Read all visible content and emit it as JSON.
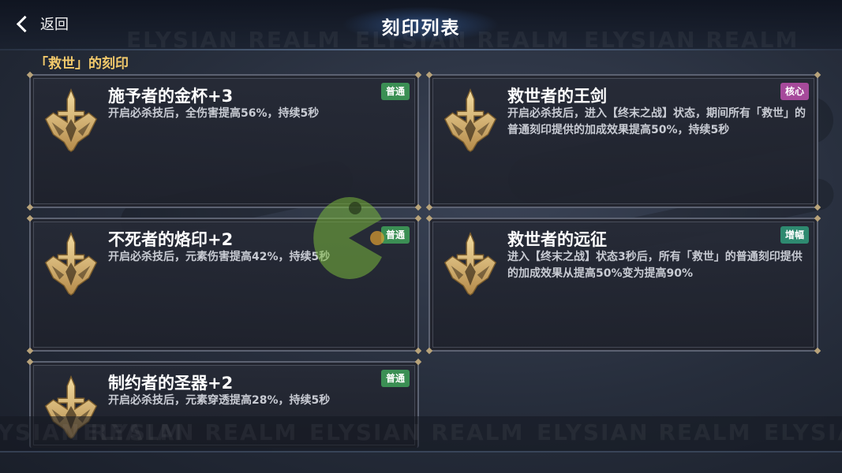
{
  "header": {
    "back_label": "返回",
    "title": "刻印列表"
  },
  "watermark_text": "ELYSIAN REALM",
  "section": {
    "heading": "「救世」的刻印"
  },
  "cards": [
    {
      "title": "施予者的金杯+3",
      "desc": "开启必杀技后，全伤害提高56%，持续5秒",
      "badge": "普通",
      "badge_color": "#3b8f54"
    },
    {
      "title": "救世者的王剑",
      "desc": "开启必杀技后，进入【终末之战】状态，期间所有「救世」的普通刻印提供的加成效果提高50%，持续5秒",
      "badge": "核心",
      "badge_color": "#a64a9b"
    },
    {
      "title": "不死者的烙印+2",
      "desc": "开启必杀技后，元素伤害提高42%，持续5秒",
      "badge": "普通",
      "badge_color": "#3b8f54"
    },
    {
      "title": "救世者的远征",
      "desc": "进入【终末之战】状态3秒后，所有「救世」的普通刻印提供的加成效果从提高50%变为提高90%",
      "badge": "增幅",
      "badge_color": "#2e8a70"
    },
    {
      "title": "制约者的圣器+2",
      "desc": "开启必杀技后，元素穿透提高28%，持续5秒",
      "badge": "普通",
      "badge_color": "#3b8f54"
    }
  ],
  "icons": {
    "back": "chevron-left-icon",
    "emblem": "sword-emblem-icon",
    "logo": "pacman-logo-icon"
  }
}
